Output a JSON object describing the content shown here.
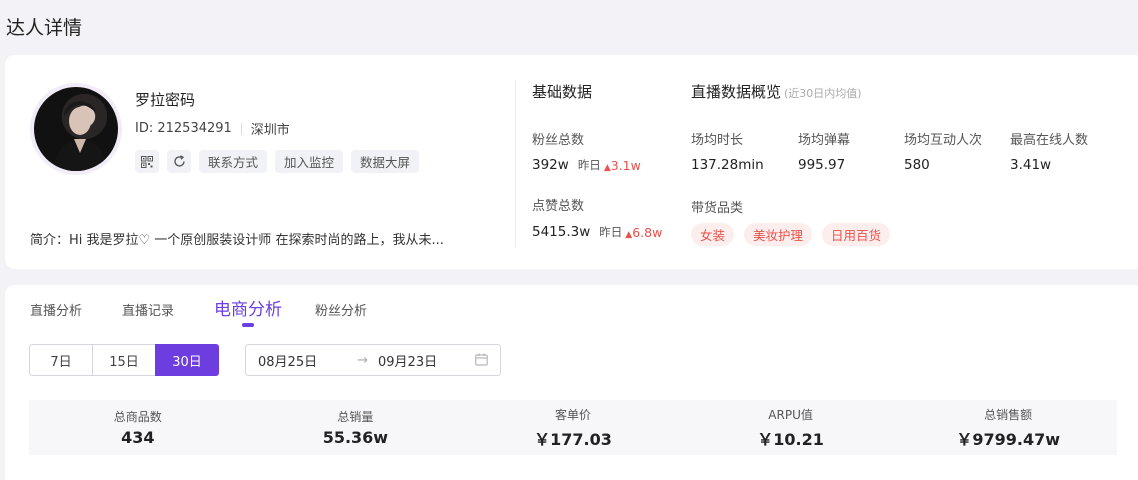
{
  "page": {
    "title": "达人详情"
  },
  "profile": {
    "nickname": "罗拉密码",
    "id_label": "ID: 212534291",
    "city": "深圳市",
    "tags": [
      "联系方式",
      "加入监控",
      "数据大屏"
    ],
    "bio": "简介：Hi 我是罗拉♡ 一个原创服装设计师 在探索时尚的路上，我从未..."
  },
  "basic": {
    "title": "基础数据",
    "fans_label": "粉丝总数",
    "fans_value": "392w",
    "fans_yday_label": "昨日",
    "fans_change": "3.1w",
    "likes_label": "点赞总数",
    "likes_value": "5415.3w",
    "likes_yday_label": "昨日",
    "likes_change": "6.8w"
  },
  "live": {
    "title": "直播数据概览",
    "subtitle": "(近30日内均值)",
    "metrics": [
      {
        "label": "场均时长",
        "value": "137.28min"
      },
      {
        "label": "场均弹幕",
        "value": "995.97"
      },
      {
        "label": "场均互动人次",
        "value": "580"
      },
      {
        "label": "最高在线人数",
        "value": "3.41w"
      }
    ],
    "category_title": "带货品类",
    "categories": [
      "女装",
      "美妆护理",
      "日用百货"
    ]
  },
  "tabs": [
    "直播分析",
    "直播记录",
    "电商分析",
    "粉丝分析"
  ],
  "active_tab": "电商分析",
  "periods": [
    "7日",
    "15日",
    "30日"
  ],
  "active_period": "30日",
  "date_range": {
    "start": "08月25日",
    "arrow": "→",
    "end": "09月23日"
  },
  "stats": [
    {
      "label": "总商品数",
      "value": "434"
    },
    {
      "label": "总销量",
      "value": "55.36w"
    },
    {
      "label": "客单价",
      "value": "￥177.03"
    },
    {
      "label": "ARPU值",
      "value": "￥10.21"
    },
    {
      "label": "总销售额",
      "value": "￥9799.47w"
    }
  ],
  "colors": {
    "accent": "#6d3de0",
    "increase": "#e8524a",
    "category_text": "#e9514a"
  }
}
